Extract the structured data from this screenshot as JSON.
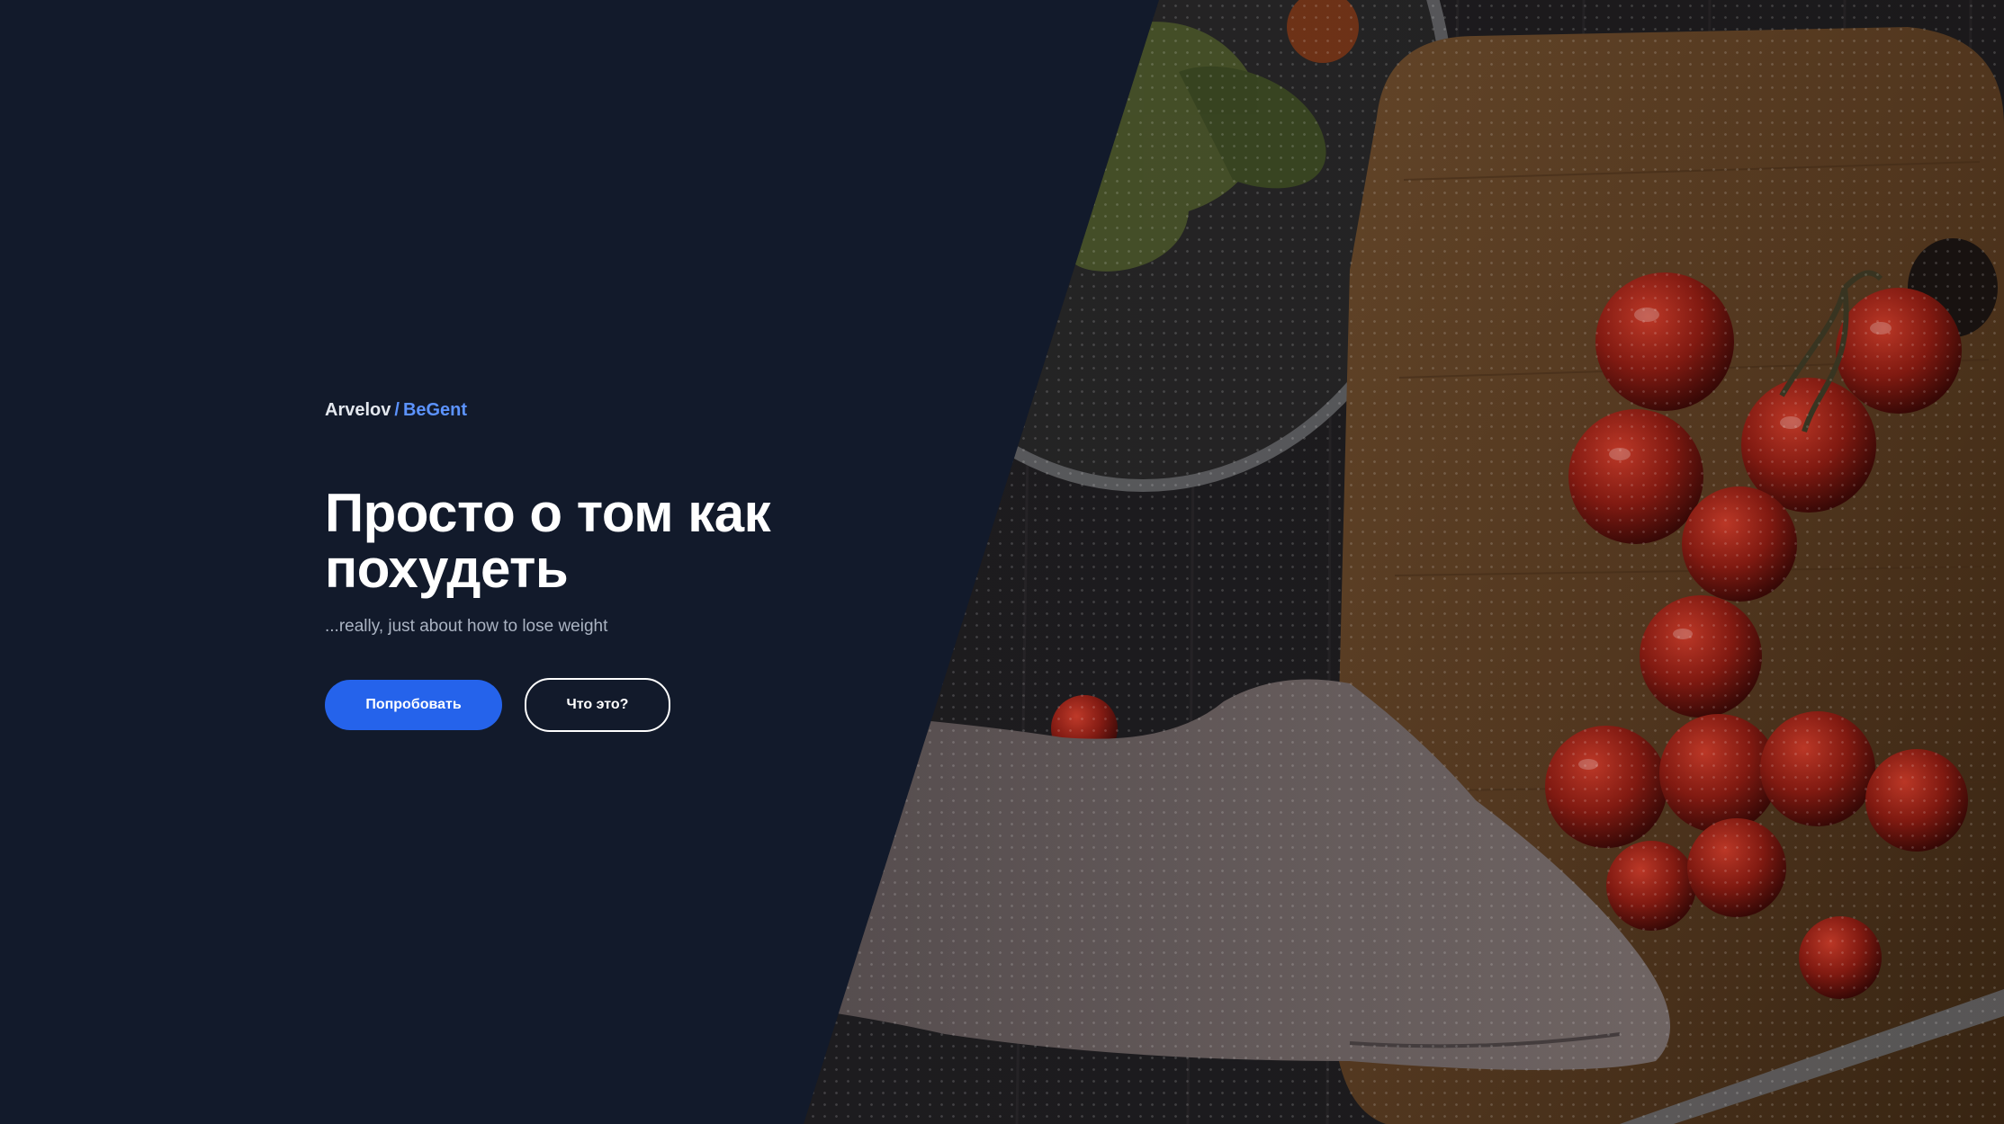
{
  "hero": {
    "breadcrumb": {
      "author": "Arvelov",
      "separator": "/",
      "brand": "BeGent"
    },
    "title_line1": "Просто о том как",
    "title_line2": "похудеть",
    "subtitle": "...really, just about how to lose weight",
    "primary_button": "Попробовать",
    "secondary_button": "Что это?"
  },
  "colors": {
    "background": "#121a2b",
    "accent": "#2563eb",
    "brand_link": "#5c93ff",
    "subtitle": "#aab3c2"
  },
  "image": {
    "subject": "cherry tomatoes on a wooden cutting board with salad bowl and hand"
  }
}
